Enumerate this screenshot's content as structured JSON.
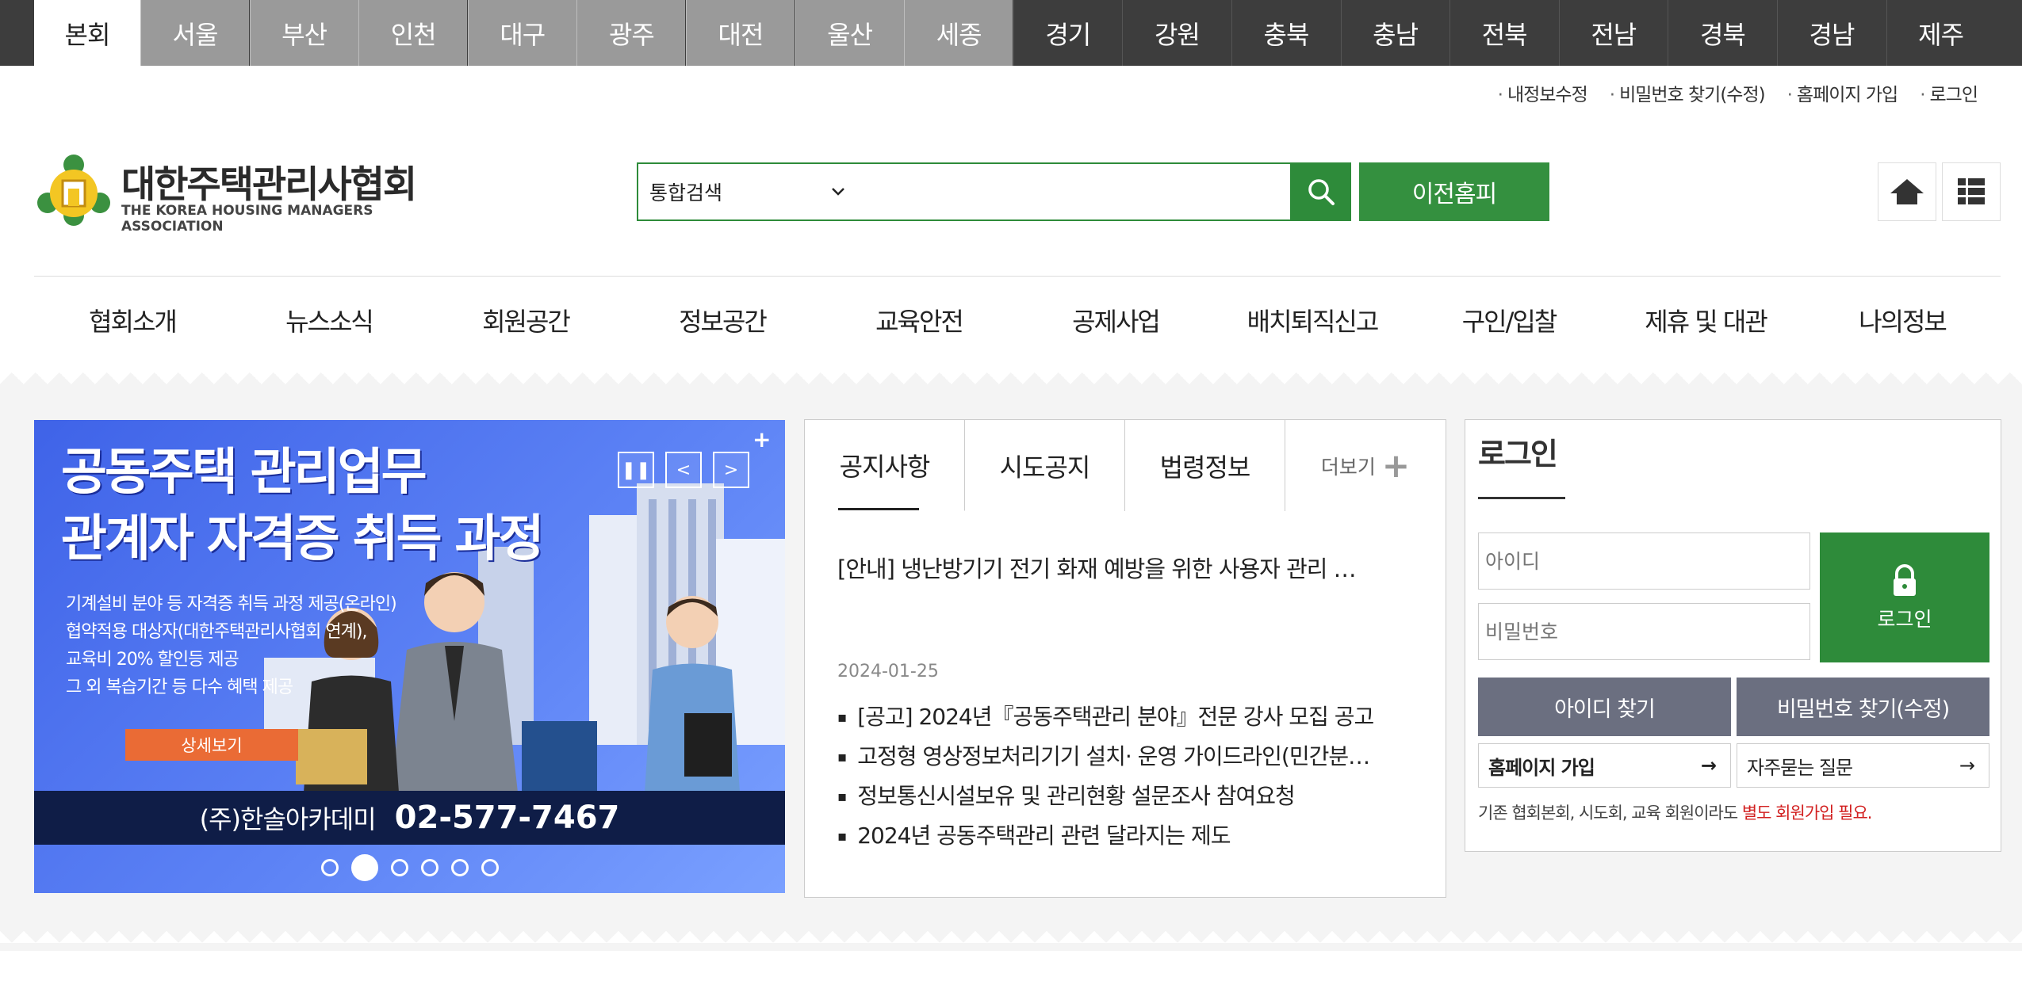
{
  "regions": {
    "active": "본회",
    "gray": [
      "서울",
      "부산",
      "인천",
      "대구",
      "광주",
      "대전",
      "울산",
      "세종"
    ],
    "dark": [
      "경기",
      "강원",
      "충북",
      "충남",
      "전북",
      "전남",
      "경북",
      "경남",
      "제주"
    ]
  },
  "util_links": [
    "내정보수정",
    "비밀번호 찾기(수정)",
    "홈페이지 가입",
    "로그인"
  ],
  "logo": {
    "name_ko": "대한주택관리사협회",
    "name_en": "THE KOREA HOUSING MANAGERS ASSOCIATION"
  },
  "search": {
    "scope": "통합검색",
    "placeholder": "",
    "prev_home": "이전홈피"
  },
  "icons": {
    "home": "home-icon",
    "sitemap": "grid-icon",
    "search": "search-icon"
  },
  "nav": [
    "협회소개",
    "뉴스소식",
    "회원공간",
    "정보공간",
    "교육안전",
    "공제사업",
    "배치퇴직신고",
    "구인/입찰",
    "제휴 및 대관",
    "나의정보"
  ],
  "banner": {
    "title_line1": "공동주택 관리업무",
    "title_line2": "관계자 자격증 취득 과정",
    "body": [
      "기계설비 분야 등 자격증 취득 과정 제공(온라인)",
      "협약적용 대상자(대한주택관리사협회 연계),",
      "교육비 20% 할인등 제공",
      "그 외 복습기간 등 다수 혜택 제공"
    ],
    "detail_label": "상세보기",
    "company": "(주)한솔아카데미",
    "phone": "02-577-7467",
    "slide_count": 6,
    "active_slide": 2
  },
  "notice": {
    "tabs": [
      "공지사항",
      "시도공지",
      "법령정보"
    ],
    "more_label": "더보기",
    "headline": "[안내] 냉난방기기 전기 화재 예방을 위한 사용자 관리 …",
    "date": "2024-01-25",
    "items": [
      "[공고] 2024년『공동주택관리 분야』전문 강사 모집 공고",
      "고정형 영상정보처리기기 설치· 운영 가이드라인(민간분…",
      "정보통신시설보유 및 관리현황 설문조사 참여요청",
      "2024년 공동주택관리 관련 달라지는 제도"
    ]
  },
  "login": {
    "title": "로그인",
    "id_placeholder": "아이디",
    "pw_placeholder": "비밀번호",
    "submit_label": "로그인",
    "find_id": "아이디 찾기",
    "find_pw": "비밀번호 찾기(수정)",
    "join_label": "홈페이지 가입",
    "faq_label": "자주묻는 질문",
    "note_prefix": "기존 협회본회, 시도회, 교육 회원이라도 ",
    "note_red": "별도 회원가입 필요."
  },
  "colors": {
    "brand_green": "#2e8b3a",
    "region_dark": "#3d3d3d",
    "region_gray": "#9a9a9a",
    "banner_blue": "#4a6df0",
    "banner_orange": "#ea6b35",
    "note_red": "#d21f1f"
  }
}
